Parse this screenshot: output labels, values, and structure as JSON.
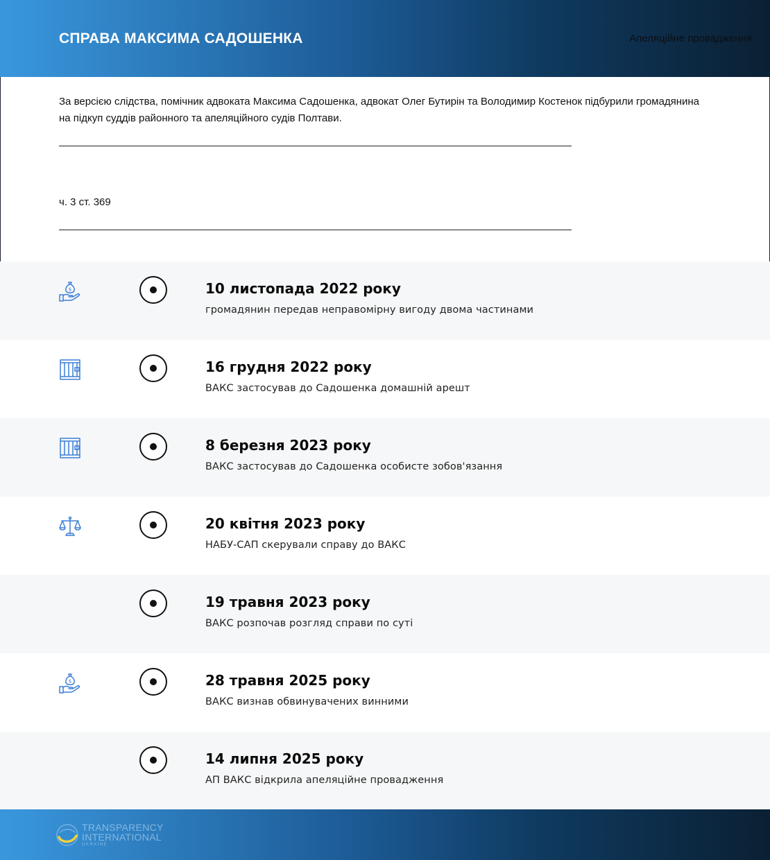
{
  "header": {
    "title": "СПРАВА МАКСИМА САДОШЕНКА",
    "status": "Апеляційне провадження"
  },
  "intro": {
    "text": "За версією слідства, помічник адвоката Максима Садошенка, адвокат Олег Бутирін та Володимир Костенок підбурили громадянина на підкуп суддів районного та апеляційного судів Полтави.",
    "article": "ч. 3 ст. 369"
  },
  "timeline": [
    {
      "date": "10 листопада 2022 року",
      "description": "громадянин передав неправомірну вигоду двома частинами",
      "icon": "money-bag-hand-icon"
    },
    {
      "date": "16 грудня 2022 року",
      "description": "ВАКС застосував до Садошенка домашній арешт",
      "icon": "jail-bars-icon"
    },
    {
      "date": "8 березня 2023 року",
      "description": "ВАКС застосував до Садошенка особисте зобов'язання",
      "icon": "jail-bars-icon"
    },
    {
      "date": "20 квітня 2023 року",
      "description": "НАБУ-САП скерували справу до ВАКС",
      "icon": "scales-icon"
    },
    {
      "date": "19 травня 2023 року",
      "description": "ВАКС розпочав розгляд справи по суті",
      "icon": ""
    },
    {
      "date": "28 травня 2025 року",
      "description": "ВАКС визнав обвинувачених винними",
      "icon": "money-bag-hand-icon"
    },
    {
      "date": "14 липня 2025 року",
      "description": "АП ВАКС відкрила апеляційне провадження",
      "icon": ""
    }
  ],
  "footer": {
    "logo_line1": "TRANSPARENCY",
    "logo_line2": "INTERNATIONAL",
    "logo_line3": "UKRAINE"
  },
  "colors": {
    "accent_icon": "#3b7fd6",
    "gradient_start": "#3a97dd",
    "gradient_end": "#0b2033",
    "row_shade": "#f6f7f8"
  }
}
